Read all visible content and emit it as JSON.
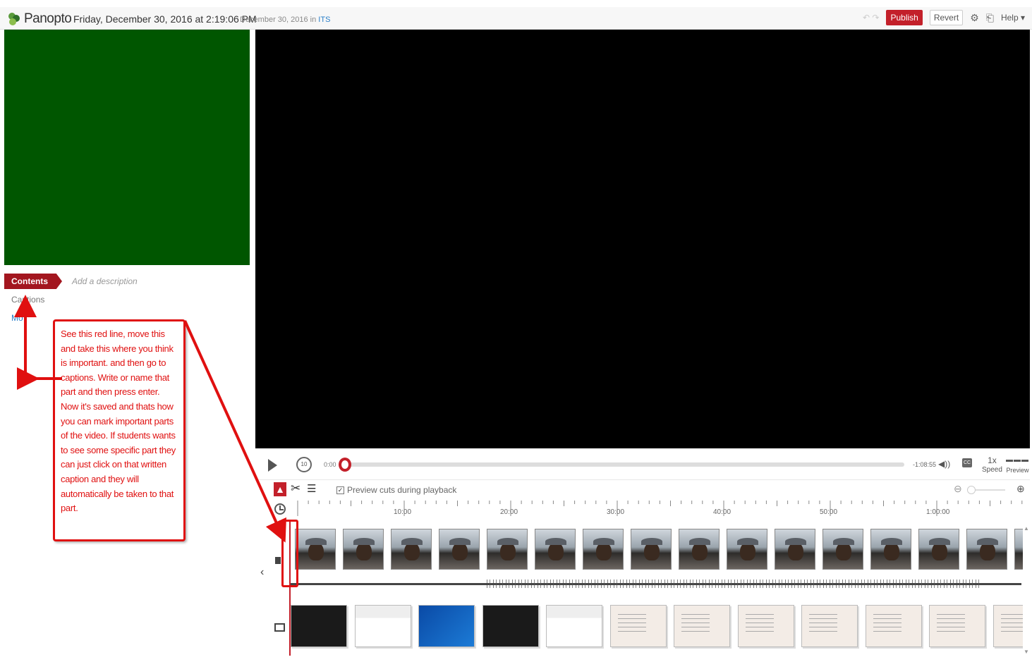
{
  "header": {
    "logo_text": "Panopto",
    "session_title": "Friday, December 30, 2016 at 2:19:06 PM",
    "session_meta_prefix": "December 30, 2016 in",
    "session_folder": "ITS",
    "undo_redo": "↶ ↷",
    "publish_label": "Publish",
    "revert_label": "Revert",
    "help_label": "Help ▾"
  },
  "left_panel": {
    "contents_tab": "Contents",
    "add_description_placeholder": "Add a description",
    "captions_link": "Captions",
    "more_link": "Mo"
  },
  "annotation": {
    "text": "See this red line, move this and take this where you think is important. and then go to captions. Write or name that part and then press enter. Now it's saved and thats how you can mark important parts of the video. If students wants to see some specific part they can just click on that written caption and they will automatically be taken to that part."
  },
  "player": {
    "current_time": "0:00",
    "remaining_time": "-1:08:55",
    "rewind_label": "10",
    "cc_label": "CC",
    "speed_value": "1x",
    "speed_label": "Speed",
    "preview_label": "Preview"
  },
  "editor": {
    "preview_cuts_label": "Preview cuts during playback",
    "preview_cuts_checked": true,
    "ruler_ticks": [
      "10:00",
      "20:00",
      "30:00",
      "40:00",
      "50:00",
      "1:00:00"
    ]
  },
  "colors": {
    "brand_red": "#c3202a",
    "annotation_red": "#e01010",
    "secondary_video_bg": "#005600"
  }
}
